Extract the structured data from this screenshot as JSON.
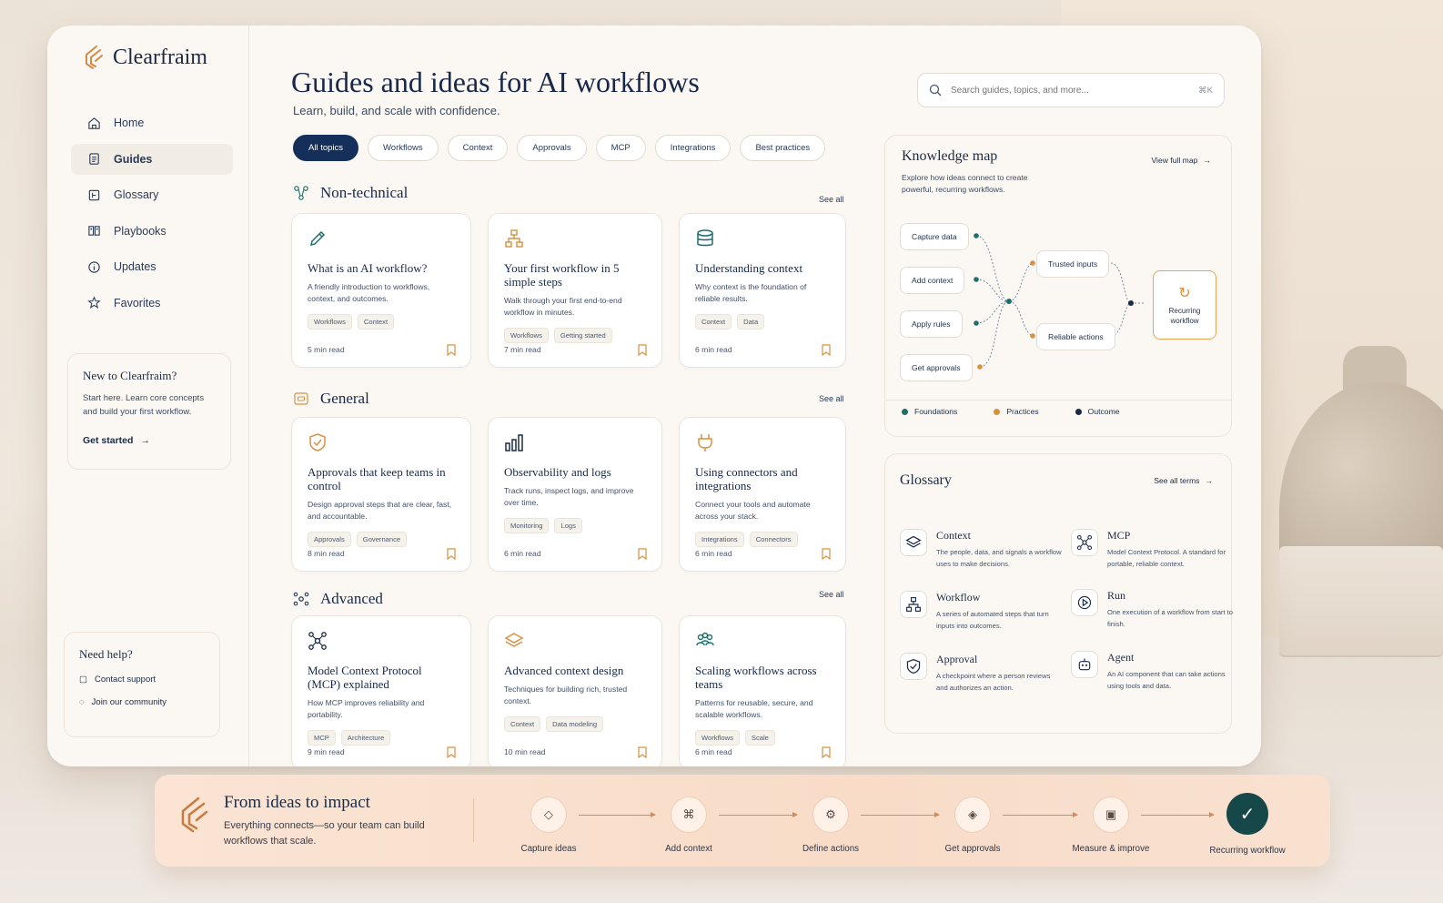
{
  "app": {
    "name": "Clearfraim"
  },
  "nav": [
    {
      "label": "Home",
      "icon": "home-icon"
    },
    {
      "label": "Guides",
      "icon": "document-icon"
    },
    {
      "label": "Glossary",
      "icon": "glossary-icon"
    },
    {
      "label": "Playbooks",
      "icon": "playbook-icon"
    },
    {
      "label": "Updates",
      "icon": "info-icon"
    },
    {
      "label": "Favorites",
      "icon": "star-icon"
    }
  ],
  "new_card": {
    "title": "New to Clearfraim?",
    "body": "Start here. Learn core concepts and build your first workflow.",
    "cta": "Get started"
  },
  "help": {
    "title": "Need help?",
    "support": "Contact support",
    "community": "Join our community"
  },
  "header": {
    "title": "Guides and ideas for AI workflows",
    "subtitle": "Learn, build, and scale with confidence."
  },
  "search": {
    "placeholder": "Search guides, topics, and more...",
    "shortcut": "⌘K"
  },
  "topics": [
    "All topics",
    "Workflows",
    "Context",
    "Approvals",
    "MCP",
    "Integrations",
    "Best practices"
  ],
  "sections": [
    {
      "title": "Non-technical",
      "see_all": "See all",
      "cards": [
        {
          "title": "What is an AI workflow?",
          "desc": "A friendly introduction to workflows, context, and outcomes.",
          "tags": [
            "Workflows",
            "Context"
          ],
          "read": "5 min read",
          "icon": "pencil-icon"
        },
        {
          "title": "Your first workflow in 5 simple steps",
          "desc": "Walk through your first end-to-end workflow in minutes.",
          "tags": [
            "Workflows",
            "Getting started"
          ],
          "read": "7 min read",
          "icon": "flow-icon"
        },
        {
          "title": "Understanding context",
          "desc": "Why context is the foundation of reliable results.",
          "tags": [
            "Context",
            "Data"
          ],
          "read": "6 min read",
          "icon": "database-icon"
        }
      ]
    },
    {
      "title": "General",
      "see_all": "See all",
      "cards": [
        {
          "title": "Approvals that keep teams in control",
          "desc": "Design approval steps that are clear, fast, and accountable.",
          "tags": [
            "Approvals",
            "Governance"
          ],
          "read": "8 min read",
          "icon": "shield-check-icon"
        },
        {
          "title": "Observability and logs",
          "desc": "Track runs, inspect logs, and improve over time.",
          "tags": [
            "Monitoring",
            "Logs"
          ],
          "read": "6 min read",
          "icon": "bar-chart-icon"
        },
        {
          "title": "Using connectors and integrations",
          "desc": "Connect your tools and automate across your stack.",
          "tags": [
            "Integrations",
            "Connectors"
          ],
          "read": "6 min read",
          "icon": "plug-icon"
        }
      ]
    },
    {
      "title": "Advanced",
      "see_all": "See all",
      "cards": [
        {
          "title": "Model Context Protocol (MCP) explained",
          "desc": "How MCP improves reliability and portability.",
          "tags": [
            "MCP",
            "Architecture"
          ],
          "read": "9 min read",
          "icon": "network-icon"
        },
        {
          "title": "Advanced context design",
          "desc": "Techniques for building rich, trusted context.",
          "tags": [
            "Context",
            "Data modeling"
          ],
          "read": "10 min read",
          "icon": "layers-icon"
        },
        {
          "title": "Scaling workflows across teams",
          "desc": "Patterns for reusable, secure, and scalable workflows.",
          "tags": [
            "Workflows",
            "Scale"
          ],
          "read": "6 min read",
          "icon": "team-icon"
        }
      ]
    }
  ],
  "kmap": {
    "title": "Knowledge map",
    "desc": "Explore how ideas connect to create powerful, recurring workflows.",
    "link": "View full map",
    "inputs": [
      "Capture data",
      "Add context",
      "Apply rules",
      "Get approvals"
    ],
    "middle": [
      "Trusted inputs",
      "Reliable actions"
    ],
    "outcome": "Recurring workflow",
    "legend": [
      {
        "label": "Foundations",
        "color": "#1f6e6a"
      },
      {
        "label": "Practices",
        "color": "#d9903f"
      },
      {
        "label": "Outcome",
        "color": "#1a2a45"
      }
    ]
  },
  "glossary": {
    "title": "Glossary",
    "link": "See all terms",
    "items": [
      {
        "term": "Context",
        "def": "The people, data, and signals a workflow uses to make decisions.",
        "icon": "layers-icon"
      },
      {
        "term": "MCP",
        "def": "Model Context Protocol. A standard for portable, reliable context.",
        "icon": "network-icon"
      },
      {
        "term": "Workflow",
        "def": "A series of automated steps that turn inputs into outcomes.",
        "icon": "flow-icon"
      },
      {
        "term": "Run",
        "def": "One execution of a workflow from start to finish.",
        "icon": "play-icon"
      },
      {
        "term": "Approval",
        "def": "A checkpoint where a person reviews and authorizes an action.",
        "icon": "shield-check-icon"
      },
      {
        "term": "Agent",
        "def": "An AI component that can take actions using tools and data.",
        "icon": "robot-icon"
      }
    ]
  },
  "impact": {
    "title": "From ideas to impact",
    "body": "Everything connects—so your team can build workflows that scale.",
    "steps": [
      "Capture ideas",
      "Add context",
      "Define actions",
      "Get approvals",
      "Measure & improve",
      "Recurring workflow"
    ]
  },
  "colors": {
    "navy": "#14305a",
    "teal": "#1f6e6a",
    "orange": "#d9903f",
    "peach": "#f8dcc8"
  }
}
